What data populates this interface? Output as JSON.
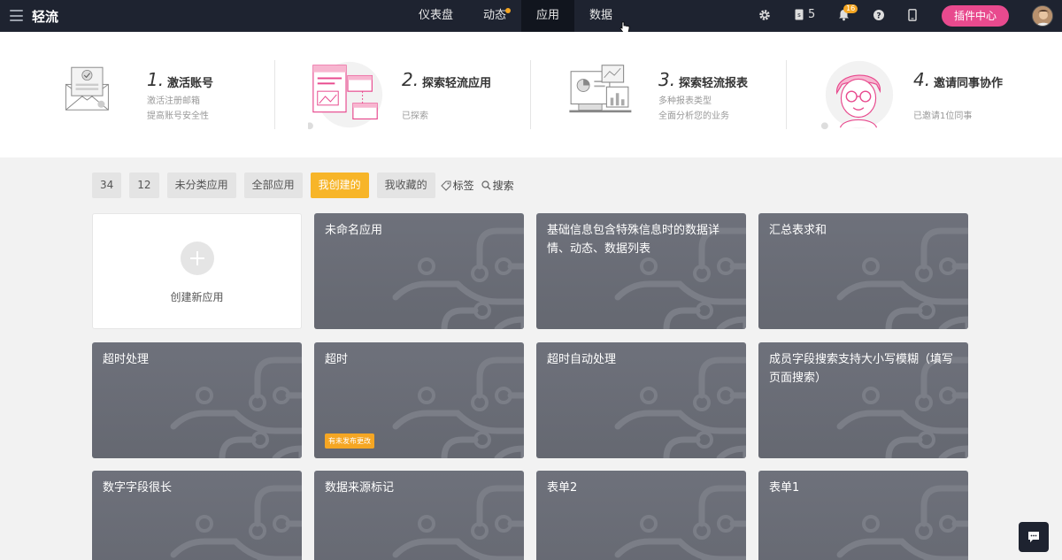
{
  "brand": "轻流",
  "nav": {
    "items": [
      {
        "label": "仪表盘"
      },
      {
        "label": "动态"
      },
      {
        "label": "应用"
      },
      {
        "label": "数据"
      }
    ]
  },
  "topbar": {
    "phone_count": "5",
    "notification_count": "16",
    "plugin_label": "插件中心"
  },
  "onboarding": {
    "steps": [
      {
        "num": "1.",
        "title": "激活账号",
        "desc1": "激活注册邮箱",
        "desc2": "提高账号安全性"
      },
      {
        "num": "2.",
        "title": "探索轻流应用",
        "desc1": "已探索",
        "desc2": ""
      },
      {
        "num": "3.",
        "title": "探索轻流报表",
        "desc1": "多种报表类型",
        "desc2": "全面分析您的业务"
      },
      {
        "num": "4.",
        "title": "邀请同事协作",
        "desc1": "已邀请1位同事",
        "desc2": ""
      }
    ]
  },
  "filters": {
    "tabs": [
      "34",
      "12",
      "未分类应用",
      "全部应用",
      "我创建的",
      "我收藏的"
    ],
    "tag_label": "标签",
    "search_label": "搜索"
  },
  "cards": {
    "new_label": "创建新应用",
    "apps": [
      {
        "title": "未命名应用"
      },
      {
        "title": "基础信息包含特殊信息时的数据详情、动态、数据列表"
      },
      {
        "title": "汇总表求和"
      },
      {
        "title": "超时处理"
      },
      {
        "title": "超时",
        "tag": "有未发布更改"
      },
      {
        "title": "超时自动处理"
      },
      {
        "title": "成员字段搜索支持大小写模糊（填写页面搜索）"
      },
      {
        "title": "数字字段很长"
      },
      {
        "title": "数据来源标记"
      },
      {
        "title": "表单2"
      },
      {
        "title": "表单1"
      }
    ]
  },
  "colors": {
    "topbar": "#1e2330",
    "accent": "#f7b529",
    "plugin": "#e84a8e",
    "card": "#6a6d76"
  }
}
